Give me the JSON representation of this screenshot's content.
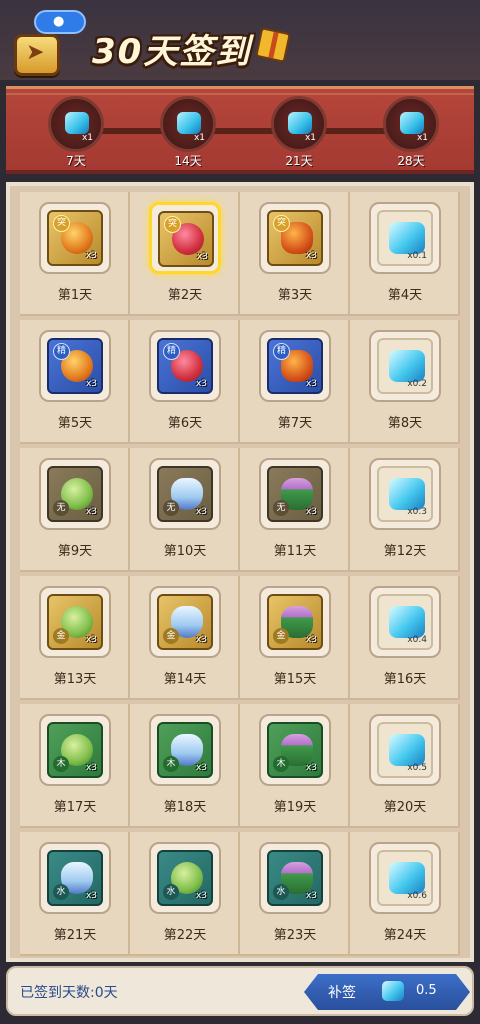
{
  "header": {
    "title": "30天签到",
    "location_icon": "location-pin-icon",
    "back_icon": "back-arrow-icon",
    "gift_icon": "gift-icon"
  },
  "milestones": [
    {
      "label": "7天",
      "count": "x1"
    },
    {
      "label": "14天",
      "count": "x1"
    },
    {
      "label": "21天",
      "count": "x1"
    },
    {
      "label": "28天",
      "count": "x1"
    }
  ],
  "days": [
    {
      "label": "第1天",
      "qty": "x3",
      "tag": "突",
      "tile": "gold",
      "item": "orb"
    },
    {
      "label": "第2天",
      "qty": "x3",
      "tag": "突",
      "tile": "gold",
      "item": "flower",
      "today": true
    },
    {
      "label": "第3天",
      "qty": "x3",
      "tag": "突",
      "tile": "gold",
      "item": "monkey"
    },
    {
      "label": "第4天",
      "qty": "x0.1",
      "tile": "plain",
      "item": "gem"
    },
    {
      "label": "第5天",
      "qty": "x3",
      "tag": "精",
      "tile": "blue",
      "item": "orb"
    },
    {
      "label": "第6天",
      "qty": "x3",
      "tag": "精",
      "tile": "blue",
      "item": "flower"
    },
    {
      "label": "第7天",
      "qty": "x3",
      "tag": "精",
      "tile": "blue",
      "item": "monkey"
    },
    {
      "label": "第8天",
      "qty": "x0.2",
      "tile": "plain",
      "item": "gem"
    },
    {
      "label": "第9天",
      "qty": "x3",
      "element": "无",
      "tile": "olive",
      "item": "melon"
    },
    {
      "label": "第10天",
      "qty": "x3",
      "element": "无",
      "tile": "olive",
      "item": "lotus"
    },
    {
      "label": "第11天",
      "qty": "x3",
      "element": "无",
      "tile": "olive",
      "item": "herb"
    },
    {
      "label": "第12天",
      "qty": "x0.3",
      "tile": "plain",
      "item": "gem"
    },
    {
      "label": "第13天",
      "qty": "x3",
      "element": "金",
      "tile": "gold",
      "item": "melon"
    },
    {
      "label": "第14天",
      "qty": "x3",
      "element": "金",
      "tile": "gold",
      "item": "lotus"
    },
    {
      "label": "第15天",
      "qty": "x3",
      "element": "金",
      "tile": "gold",
      "item": "herb"
    },
    {
      "label": "第16天",
      "qty": "x0.4",
      "tile": "plain",
      "item": "gem"
    },
    {
      "label": "第17天",
      "qty": "x3",
      "element": "木",
      "tile": "green",
      "item": "melon"
    },
    {
      "label": "第18天",
      "qty": "x3",
      "element": "木",
      "tile": "green",
      "item": "lotus"
    },
    {
      "label": "第19天",
      "qty": "x3",
      "element": "木",
      "tile": "green",
      "item": "herb"
    },
    {
      "label": "第20天",
      "qty": "x0.5",
      "tile": "plain",
      "item": "gem"
    },
    {
      "label": "第21天",
      "qty": "x3",
      "element": "水",
      "tile": "teal",
      "item": "lotus"
    },
    {
      "label": "第22天",
      "qty": "x3",
      "element": "水",
      "tile": "teal",
      "item": "melon"
    },
    {
      "label": "第23天",
      "qty": "x3",
      "element": "水",
      "tile": "teal",
      "item": "herb"
    },
    {
      "label": "第24天",
      "qty": "x0.6",
      "tile": "plain",
      "item": "gem"
    }
  ],
  "footer": {
    "signed_text": "已签到天数:0天",
    "makeup_label": "补签",
    "makeup_cost": "0.5"
  }
}
